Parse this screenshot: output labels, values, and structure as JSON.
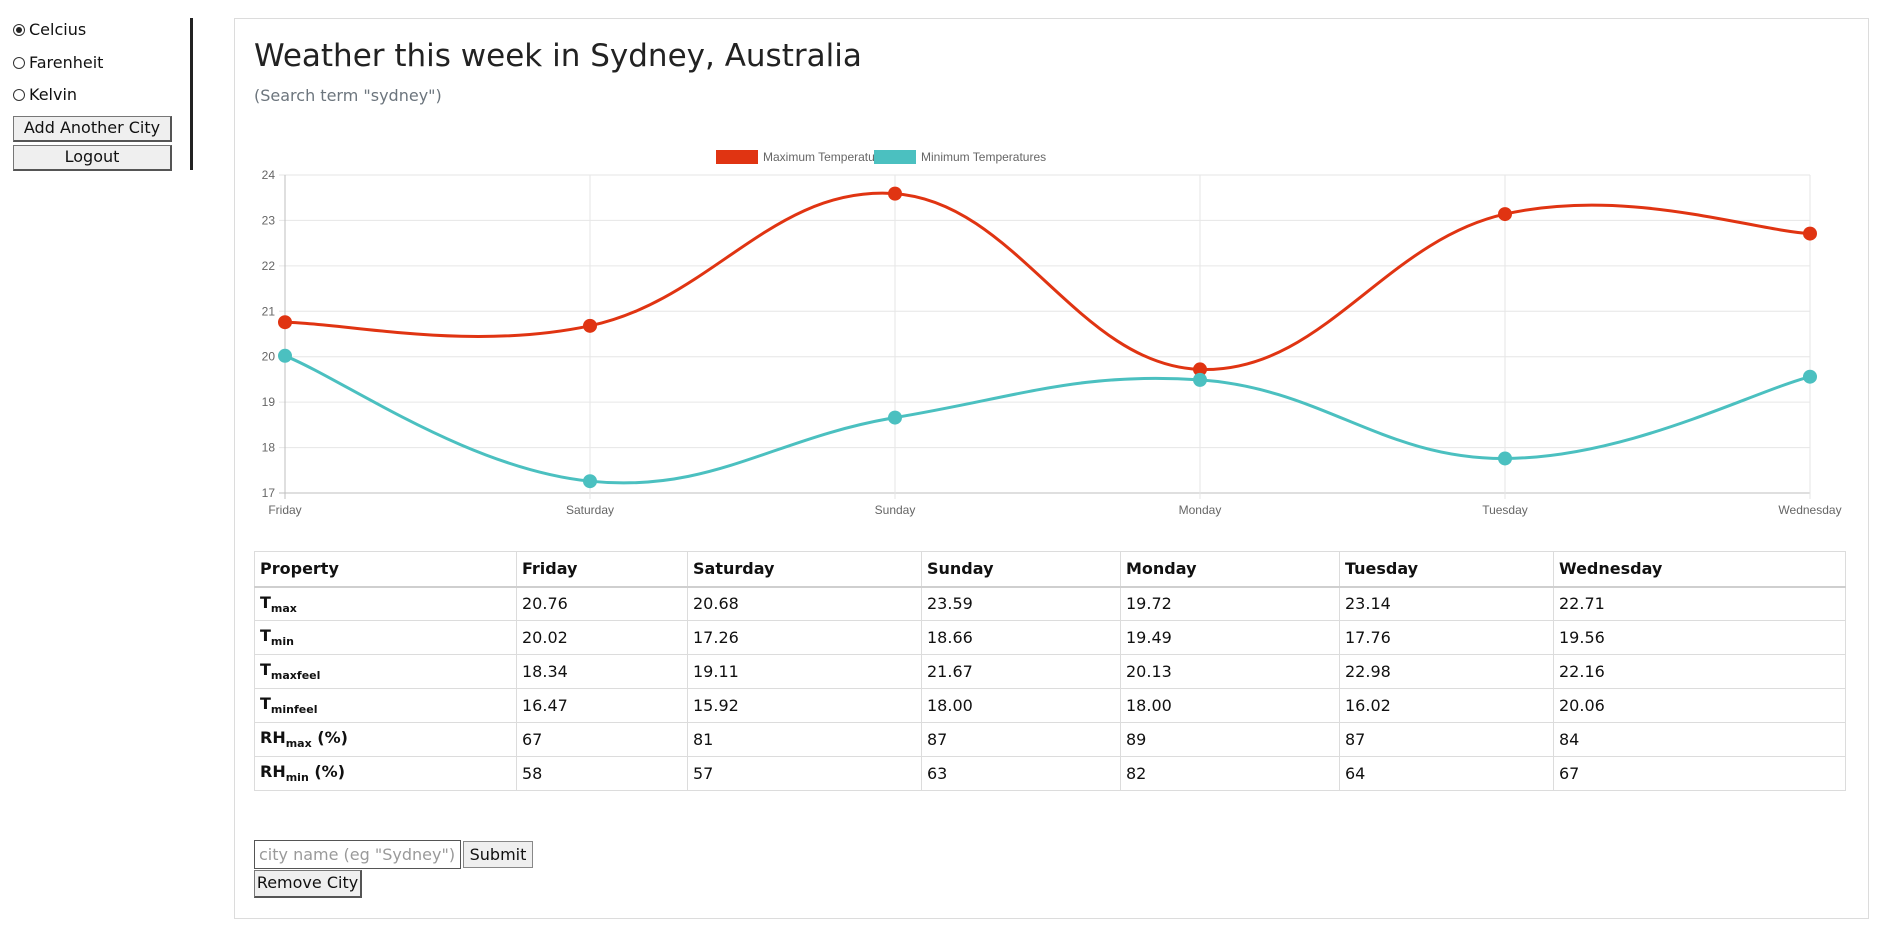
{
  "units": {
    "options": [
      "Celcius",
      "Farenheit",
      "Kelvin"
    ],
    "selected": "Celcius"
  },
  "sidebar": {
    "add_city_label": "Add Another City",
    "logout_label": "Logout"
  },
  "header": {
    "title": "Weather this week in Sydney, Australia",
    "subtitle": "(Search term \"sydney\")"
  },
  "chart_data": {
    "type": "line",
    "categories": [
      "Friday",
      "Saturday",
      "Sunday",
      "Monday",
      "Tuesday",
      "Wednesday"
    ],
    "series": [
      {
        "name": "Maximum Temperatures",
        "color": "#e03412",
        "values": [
          20.76,
          20.68,
          23.59,
          19.72,
          23.14,
          22.71
        ]
      },
      {
        "name": "Minimum Temperatures",
        "color": "#4bc0c0",
        "values": [
          20.02,
          17.26,
          18.66,
          19.49,
          17.76,
          19.56
        ]
      }
    ],
    "ylim": [
      17,
      24
    ],
    "yticks": [
      17,
      18,
      19,
      20,
      21,
      22,
      23,
      24
    ],
    "legend": "top-center",
    "grid": true
  },
  "table": {
    "headers": [
      "Property",
      "Friday",
      "Saturday",
      "Sunday",
      "Monday",
      "Tuesday",
      "Wednesday"
    ],
    "rows": [
      {
        "base": "T",
        "sub": "max",
        "suffix": "",
        "values": [
          "20.76",
          "20.68",
          "23.59",
          "19.72",
          "23.14",
          "22.71"
        ]
      },
      {
        "base": "T",
        "sub": "min",
        "suffix": "",
        "values": [
          "20.02",
          "17.26",
          "18.66",
          "19.49",
          "17.76",
          "19.56"
        ]
      },
      {
        "base": "T",
        "sub": "maxfeel",
        "suffix": "",
        "values": [
          "18.34",
          "19.11",
          "21.67",
          "20.13",
          "22.98",
          "22.16"
        ]
      },
      {
        "base": "T",
        "sub": "minfeel",
        "suffix": "",
        "values": [
          "16.47",
          "15.92",
          "18.00",
          "18.00",
          "16.02",
          "20.06"
        ]
      },
      {
        "base": "RH",
        "sub": "max",
        "suffix": " (%)",
        "values": [
          "67",
          "81",
          "87",
          "89",
          "87",
          "84"
        ]
      },
      {
        "base": "RH",
        "sub": "min",
        "suffix": " (%)",
        "values": [
          "58",
          "57",
          "63",
          "82",
          "64",
          "67"
        ]
      }
    ]
  },
  "search": {
    "placeholder": "city name (eg \"Sydney\")",
    "value": "",
    "submit_label": "Submit",
    "remove_label": "Remove City"
  }
}
